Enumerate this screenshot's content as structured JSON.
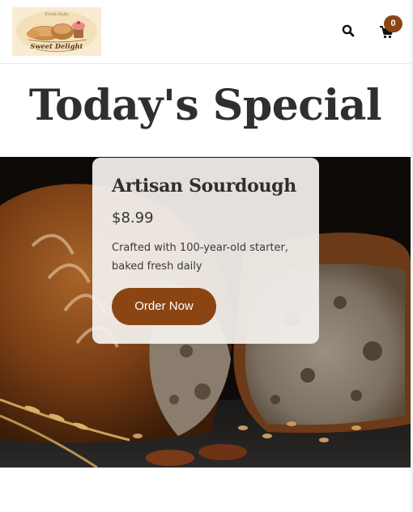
{
  "header": {
    "logo": {
      "arc_text": "Fresh Daily",
      "name": "Sweet Delight"
    },
    "search_icon": "search-icon",
    "cart_icon": "cart-icon",
    "cart_count": "0"
  },
  "main": {
    "title": "Today's Special"
  },
  "special": {
    "name": "Artisan Sourdough",
    "price": "$8.99",
    "description": "Crafted with 100-year-old starter, baked fresh daily",
    "cta": "Order Now"
  },
  "colors": {
    "accent": "#8b4513",
    "heading": "#2f2f2f",
    "logo_bg": "#f8ecd4"
  }
}
